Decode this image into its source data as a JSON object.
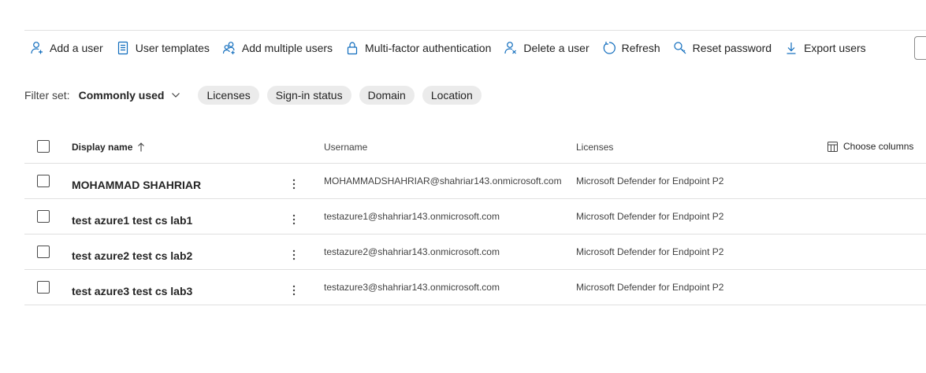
{
  "toolbar": {
    "add_user": "Add a user",
    "user_templates": "User templates",
    "add_multiple_users": "Add multiple users",
    "mfa": "Multi-factor authentication",
    "delete_user": "Delete a user",
    "refresh": "Refresh",
    "reset_password": "Reset password",
    "export_users": "Export users"
  },
  "filters": {
    "label": "Filter set:",
    "selected_set": "Commonly used",
    "pills": [
      "Licenses",
      "Sign-in status",
      "Domain",
      "Location"
    ]
  },
  "table": {
    "columns": {
      "display_name": "Display name",
      "username": "Username",
      "licenses": "Licenses",
      "choose_columns": "Choose columns"
    },
    "rows": [
      {
        "display_name": "MOHAMMAD SHAHRIAR",
        "username": "MOHAMMADSHAHRIAR@shahriar143.onmicrosoft.com",
        "licenses": "Microsoft Defender for Endpoint P2"
      },
      {
        "display_name": "test azure1 test cs lab1",
        "username": "testazure1@shahriar143.onmicrosoft.com",
        "licenses": "Microsoft Defender for Endpoint P2"
      },
      {
        "display_name": "test azure2 test cs lab2",
        "username": "testazure2@shahriar143.onmicrosoft.com",
        "licenses": "Microsoft Defender for Endpoint P2"
      },
      {
        "display_name": "test azure3 test cs lab3",
        "username": "testazure3@shahriar143.onmicrosoft.com",
        "licenses": "Microsoft Defender for Endpoint P2"
      }
    ]
  },
  "icons": {
    "add_user": "person-add-icon",
    "user_templates": "document-icon",
    "add_multiple_users": "people-add-icon",
    "mfa": "lock-icon",
    "delete_user": "person-delete-icon",
    "refresh": "refresh-icon",
    "reset_password": "key-search-icon",
    "export_users": "download-icon",
    "sort": "arrow-up-icon",
    "choose_columns": "columns-icon",
    "more": "more-vertical-icon"
  },
  "colors": {
    "accent": "#0f6cbd",
    "pill_bg": "#ebebeb",
    "divider": "#e0e0e0"
  }
}
